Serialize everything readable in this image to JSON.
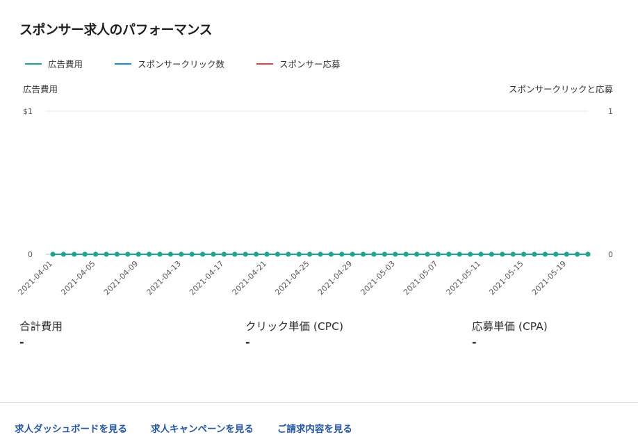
{
  "page": {
    "title": "スポンサー求人のパフォーマンス"
  },
  "chart_data": {
    "type": "line",
    "legend_position": "top-left",
    "grid": true,
    "x": [
      "2021-04-01",
      "2021-04-02",
      "2021-04-03",
      "2021-04-04",
      "2021-04-05",
      "2021-04-06",
      "2021-04-07",
      "2021-04-08",
      "2021-04-09",
      "2021-04-10",
      "2021-04-11",
      "2021-04-12",
      "2021-04-13",
      "2021-04-14",
      "2021-04-15",
      "2021-04-16",
      "2021-04-17",
      "2021-04-18",
      "2021-04-19",
      "2021-04-20",
      "2021-04-21",
      "2021-04-22",
      "2021-04-23",
      "2021-04-24",
      "2021-04-25",
      "2021-04-26",
      "2021-04-27",
      "2021-04-28",
      "2021-04-29",
      "2021-04-30",
      "2021-05-01",
      "2021-05-02",
      "2021-05-03",
      "2021-05-04",
      "2021-05-05",
      "2021-05-06",
      "2021-05-07",
      "2021-05-08",
      "2021-05-09",
      "2021-05-10",
      "2021-05-11",
      "2021-05-12",
      "2021-05-13",
      "2021-05-14",
      "2021-05-15",
      "2021-05-16",
      "2021-05-17",
      "2021-05-18",
      "2021-05-19",
      "2021-05-20",
      "2021-05-21"
    ],
    "x_tick_labels": [
      "2021-04-01",
      "2021-04-05",
      "2021-04-09",
      "2021-04-13",
      "2021-04-17",
      "2021-04-21",
      "2021-04-25",
      "2021-04-29",
      "2021-05-03",
      "2021-05-07",
      "2021-05-11",
      "2021-05-15",
      "2021-05-19"
    ],
    "ylabel_left": "広告費用",
    "ylabel_right": "スポンサークリックと応募",
    "y_left_ticks": [
      "0",
      "$1"
    ],
    "y_right_ticks": [
      "0",
      "1"
    ],
    "ylim_left": [
      0,
      1
    ],
    "ylim_right": [
      0,
      1
    ],
    "series": [
      {
        "name": "広告費用",
        "color": "#1ca58d",
        "axis": "left",
        "values": [
          0,
          0,
          0,
          0,
          0,
          0,
          0,
          0,
          0,
          0,
          0,
          0,
          0,
          0,
          0,
          0,
          0,
          0,
          0,
          0,
          0,
          0,
          0,
          0,
          0,
          0,
          0,
          0,
          0,
          0,
          0,
          0,
          0,
          0,
          0,
          0,
          0,
          0,
          0,
          0,
          0,
          0,
          0,
          0,
          0,
          0,
          0,
          0,
          0,
          0,
          0
        ]
      },
      {
        "name": "スポンサークリック数",
        "color": "#1a8fc7",
        "axis": "right",
        "values": [
          0,
          0,
          0,
          0,
          0,
          0,
          0,
          0,
          0,
          0,
          0,
          0,
          0,
          0,
          0,
          0,
          0,
          0,
          0,
          0,
          0,
          0,
          0,
          0,
          0,
          0,
          0,
          0,
          0,
          0,
          0,
          0,
          0,
          0,
          0,
          0,
          0,
          0,
          0,
          0,
          0,
          0,
          0,
          0,
          0,
          0,
          0,
          0,
          0,
          0,
          0
        ]
      },
      {
        "name": "スポンサー応募",
        "color": "#d64545",
        "axis": "right",
        "values": [
          0,
          0,
          0,
          0,
          0,
          0,
          0,
          0,
          0,
          0,
          0,
          0,
          0,
          0,
          0,
          0,
          0,
          0,
          0,
          0,
          0,
          0,
          0,
          0,
          0,
          0,
          0,
          0,
          0,
          0,
          0,
          0,
          0,
          0,
          0,
          0,
          0,
          0,
          0,
          0,
          0,
          0,
          0,
          0,
          0,
          0,
          0,
          0,
          0,
          0,
          0
        ]
      }
    ]
  },
  "metrics": [
    {
      "label": "合計費用",
      "value": "-"
    },
    {
      "label": "クリック単価 (CPC)",
      "value": "-"
    },
    {
      "label": "応募単価 (CPA)",
      "value": "-"
    }
  ],
  "footer": {
    "links": [
      "求人ダッシュボードを見る",
      "求人キャンペーンを見る",
      "ご請求内容を見る"
    ]
  }
}
